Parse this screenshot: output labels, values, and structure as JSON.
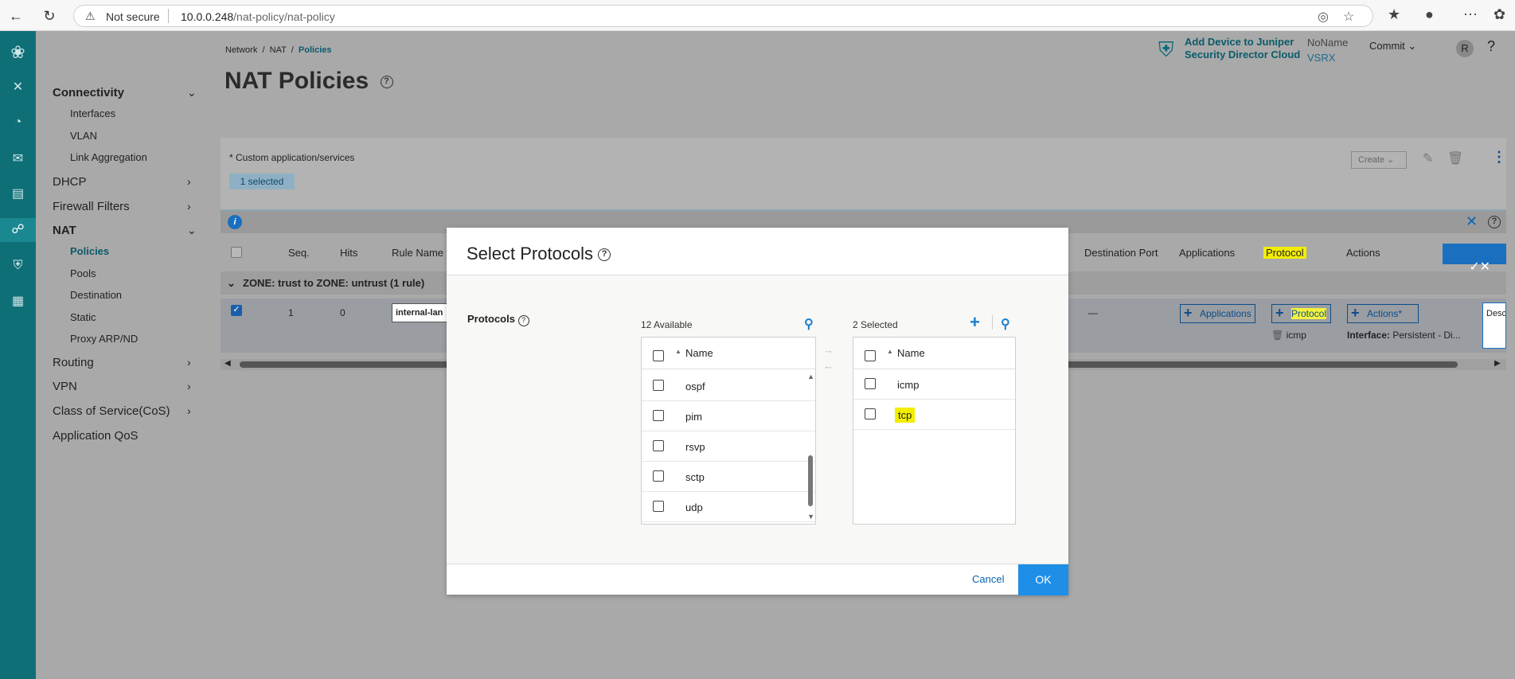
{
  "browser": {
    "security_label": "Not secure",
    "url_host": "10.0.0.248",
    "url_path": "/nat-policy/nat-policy"
  },
  "sidebar": {
    "sections": [
      {
        "label": "Connectivity",
        "expanded": true,
        "items": [
          "Interfaces",
          "VLAN",
          "Link Aggregation"
        ]
      },
      {
        "label": "DHCP",
        "expanded": false
      },
      {
        "label": "Firewall Filters",
        "expanded": false
      },
      {
        "label": "NAT",
        "expanded": true,
        "items": [
          "Policies",
          "Pools",
          "Destination",
          "Static",
          "Proxy ARP/ND"
        ]
      },
      {
        "label": "Routing",
        "expanded": false
      },
      {
        "label": "VPN",
        "expanded": false
      },
      {
        "label": "Class of Service(CoS)",
        "expanded": false
      },
      {
        "label": "Application QoS",
        "expanded": false
      }
    ]
  },
  "header": {
    "breadcrumb": [
      "Network",
      "NAT",
      "Policies"
    ],
    "page_title": "NAT Policies",
    "juniper_link_line1": "Add Device to Juniper",
    "juniper_link_line2": "Security Director Cloud",
    "device_name": "NoName",
    "device_model": "VSRX",
    "commit_label": "Commit",
    "avatar_letter": "R",
    "help_glyph": "?"
  },
  "toolbar": {
    "custom_note": "* Custom application/services",
    "selected_badge": "1 selected",
    "create_label": "Create"
  },
  "grid": {
    "columns": [
      "Seq.",
      "Hits",
      "Rule Name",
      "Destination Port",
      "Applications",
      "Protocol",
      "Actions"
    ],
    "zone_label": "ZONE: trust to ZONE: untrust (1 rule)",
    "row": {
      "seq": "1",
      "hits": "0",
      "rule_name": "internal-lan",
      "dest_port": "—",
      "applications_btn": "Applications",
      "protocol_btn": "Protocol",
      "protocol_value": "icmp",
      "actions_btn": "Actions*",
      "interface_label": "Interface:",
      "interface_value": "Persistent - Di...",
      "desc_cut": "Desc"
    }
  },
  "modal": {
    "title": "Select Protocols",
    "protocols_label": "Protocols",
    "available_count": "12 Available",
    "selected_count": "2 Selected",
    "name_header": "Name",
    "available_items": [
      "ospf",
      "pim",
      "rsvp",
      "sctp",
      "udp"
    ],
    "selected_items": [
      "icmp",
      "tcp"
    ],
    "cancel_label": "Cancel",
    "ok_label": "OK"
  },
  "colors": {
    "rail": "#0f6f77",
    "primary_button": "#1e8ee6",
    "highlight": "#f5f23a"
  }
}
